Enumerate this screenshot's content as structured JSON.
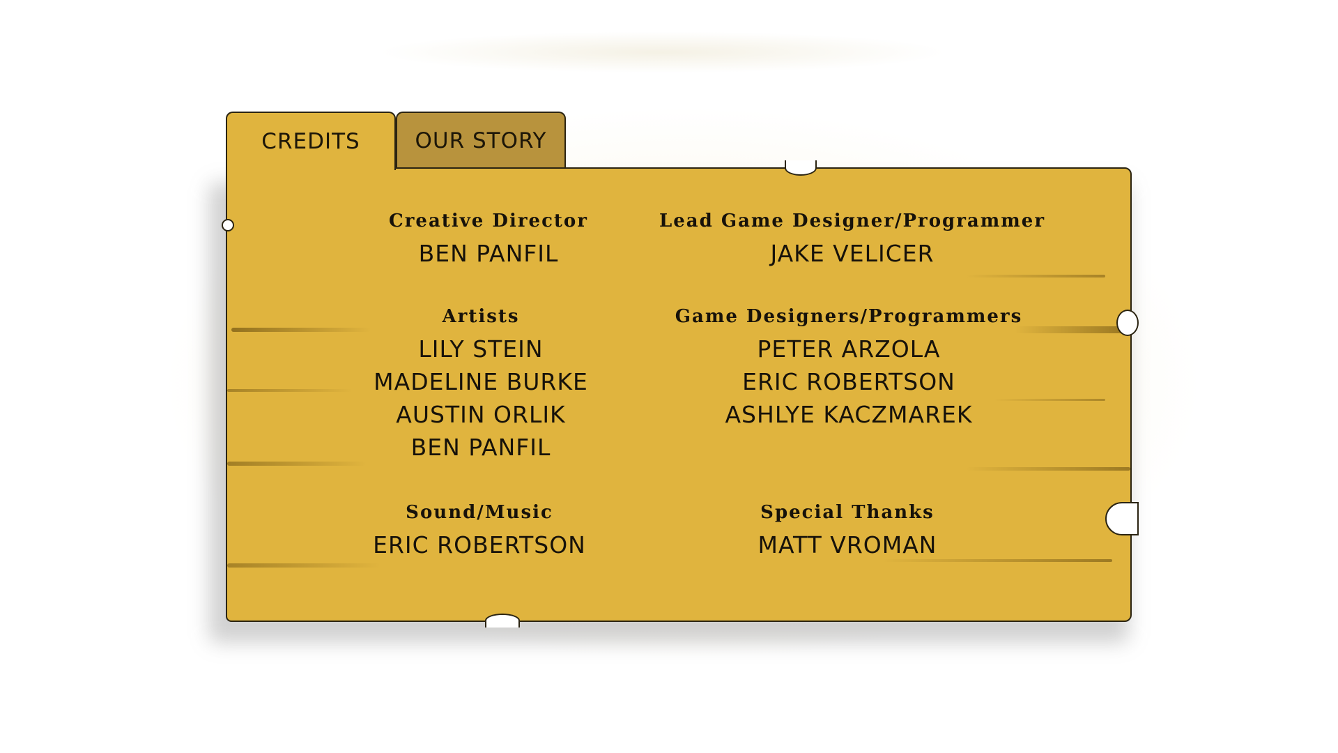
{
  "tabs": [
    {
      "label": "CREDITS",
      "active": true
    },
    {
      "label": "OUR STORY",
      "active": false
    }
  ],
  "credits": [
    {
      "role": "Creative Director",
      "names": [
        "BEN PANFIL"
      ]
    },
    {
      "role": "Lead Game Designer/Programmer",
      "names": [
        "JAKE VELICER"
      ]
    },
    {
      "role": "Artists",
      "names": [
        "LILY STEIN",
        "MADELINE BURKE",
        "AUSTIN ORLIK",
        "BEN PANFIL"
      ]
    },
    {
      "role": "Game Designers/Programmers",
      "names": [
        "PETER ARZOLA",
        "ERIC ROBERTSON",
        "ASHLYE KACZMAREK"
      ]
    },
    {
      "role": "Sound/Music",
      "names": [
        "ERIC ROBERTSON"
      ]
    },
    {
      "role": "Special Thanks",
      "names": [
        "MATT VROMAN"
      ]
    }
  ],
  "colors": {
    "parchment": "#e0b43e",
    "inactive_tab": "#b8933d",
    "outline": "#2b2412",
    "text": "#17120a"
  }
}
